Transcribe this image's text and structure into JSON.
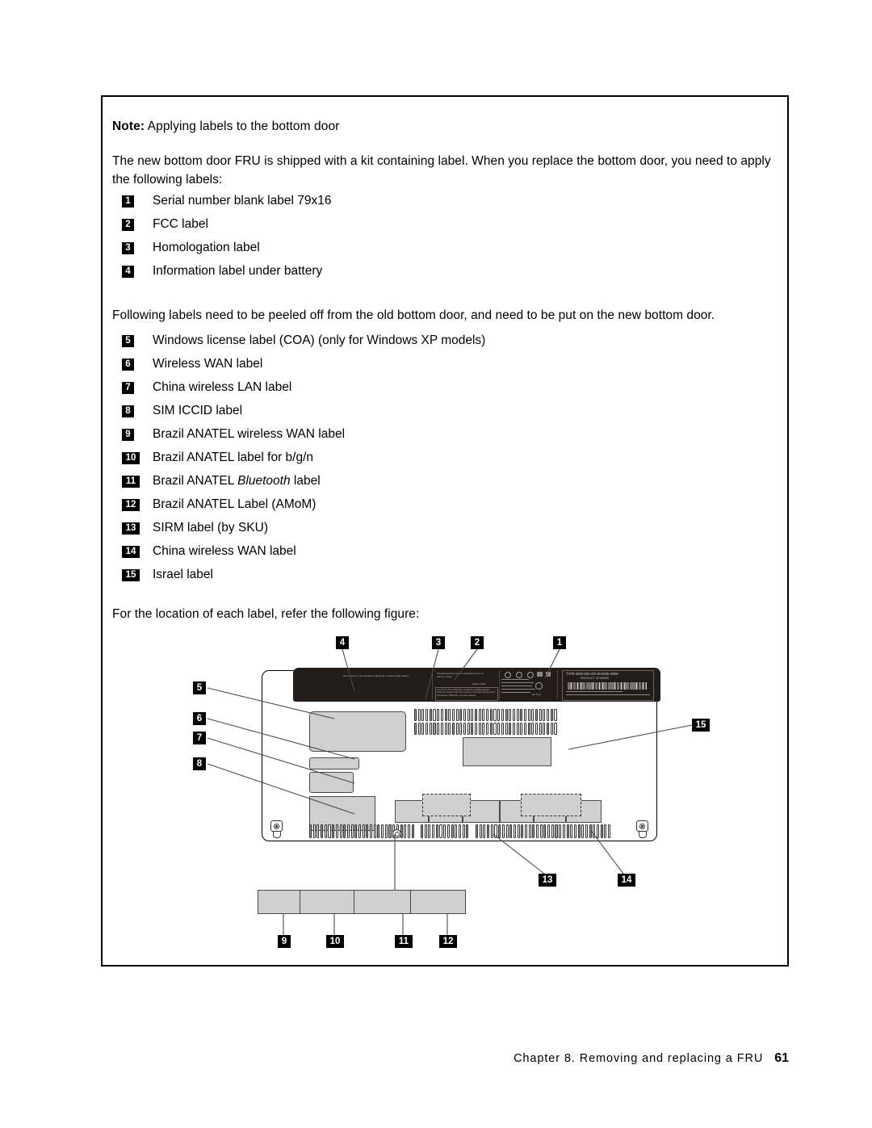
{
  "note": {
    "label": "Note:",
    "text": "Applying labels to the bottom door"
  },
  "paragraphs": {
    "intro": "The new bottom door FRU is shipped with a kit containing label. When you replace the bottom door, you need to apply the following labels:",
    "peel": "Following labels need to be peeled off from the old bottom door, and need to be put on the new bottom door.",
    "refer": "For the location of each label, refer the following figure:"
  },
  "list_apply": [
    {
      "num": "1",
      "text": "Serial number blank label 79x16"
    },
    {
      "num": "2",
      "text": "FCC label"
    },
    {
      "num": "3",
      "text": "Homologation label"
    },
    {
      "num": "4",
      "text": "Information label under battery"
    }
  ],
  "list_peel": [
    {
      "num": "5",
      "text": "Windows license label (COA) (only for Windows XP models)"
    },
    {
      "num": "6",
      "text": "Wireless WAN label"
    },
    {
      "num": "7",
      "text": "China wireless LAN label"
    },
    {
      "num": "8",
      "text": "SIM ICCID label"
    },
    {
      "num": "9",
      "text": "Brazil ANATEL wireless WAN label"
    },
    {
      "num": "10",
      "text": "Brazil ANATEL label for b/g/n"
    },
    {
      "num": "11",
      "text": "Brazil ANATEL Bluetooth label",
      "italic_word": "Bluetooth"
    },
    {
      "num": "12",
      "text": "Brazil ANATEL Label (AMoM)"
    },
    {
      "num": "13",
      "text": "SIRM label (by SKU)"
    },
    {
      "num": "14",
      "text": "China wireless WAN label"
    },
    {
      "num": "15",
      "text": "Israel label"
    }
  ],
  "figure": {
    "callouts": [
      {
        "id": "fig-callout-4",
        "num": "4"
      },
      {
        "id": "fig-callout-3",
        "num": "3"
      },
      {
        "id": "fig-callout-2",
        "num": "2"
      },
      {
        "id": "fig-callout-1",
        "num": "1"
      },
      {
        "id": "fig-callout-5",
        "num": "5"
      },
      {
        "id": "fig-callout-6",
        "num": "6"
      },
      {
        "id": "fig-callout-7",
        "num": "7"
      },
      {
        "id": "fig-callout-8",
        "num": "8"
      },
      {
        "id": "fig-callout-15",
        "num": "15"
      },
      {
        "id": "fig-callout-13",
        "num": "13"
      },
      {
        "id": "fig-callout-14",
        "num": "14"
      },
      {
        "id": "fig-callout-9",
        "num": "9"
      },
      {
        "id": "fig-callout-10",
        "num": "10"
      },
      {
        "id": "fig-callout-11",
        "num": "11"
      },
      {
        "id": "fig-callout-12",
        "num": "12"
      }
    ],
    "regulatory_strip": {
      "battery_note": "Some agency and regulatory labels are located under battery",
      "manufacturer": "Manufactured by Lenovo (Singapore) Pte Ltd",
      "made_in": "Made in China",
      "model": "Model: X230",
      "fcc_note": "FCC ID / IC ID: Certification number for installed wireless cards are located under the customer removable access panel (Keyboard or Palmrest - see user manual)",
      "eu_only": "EU Only",
      "type_line": "TYPE 0000-000  S/N 00-0000  00/00",
      "product_line": "PRODUCT ID 000000"
    }
  },
  "footer": {
    "text": "Chapter 8. Removing and replacing a FRU",
    "page": "61"
  },
  "colors": {
    "label_fill": "#cfcfcf",
    "label_stroke": "#4a4a4a",
    "strip_dark": "#241c18",
    "callout_bg": "#000000",
    "callout_fg": "#ffffff"
  }
}
